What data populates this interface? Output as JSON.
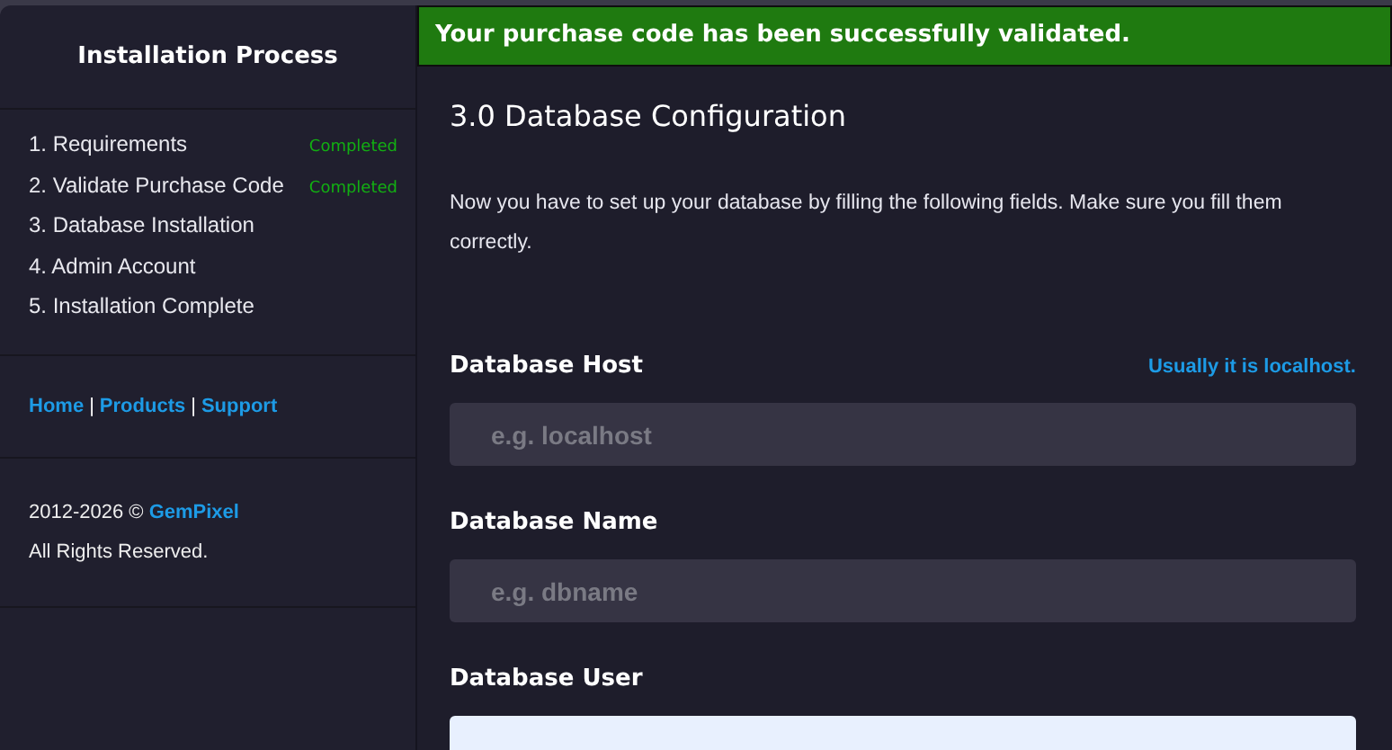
{
  "sidebar": {
    "title": "Installation Process",
    "steps": [
      {
        "label": "1. Requirements",
        "status": "Completed"
      },
      {
        "label": "2. Validate Purchase Code",
        "status": "Completed"
      },
      {
        "label": "3. Database Installation"
      },
      {
        "label": "4. Admin Account"
      },
      {
        "label": "5. Installation Complete"
      }
    ],
    "links": [
      "Home",
      "Products",
      "Support"
    ],
    "separator": "|",
    "copyright": {
      "years": "2012-2026 ©",
      "brand": "GemPixel",
      "rights": "All Rights Reserved."
    }
  },
  "alert": {
    "message": "Your purchase code has been successfully validated."
  },
  "main": {
    "heading": "3.0 Database Configuration",
    "intro": "Now you have to set up your database by filling the following fields. Make sure you fill them correctly.",
    "fields": [
      {
        "label": "Database Host",
        "hint": "Usually it is localhost.",
        "placeholder": "e.g. localhost",
        "autofilled": false
      },
      {
        "label": "Database Name",
        "placeholder": "e.g. dbname",
        "autofilled": false
      },
      {
        "label": "Database User",
        "autofilled": true
      }
    ]
  }
}
